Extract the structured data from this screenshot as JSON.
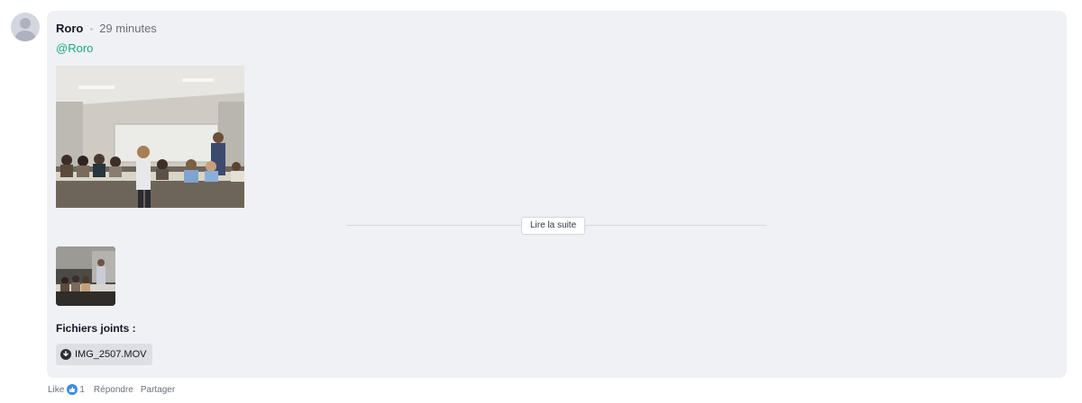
{
  "post": {
    "author": "Roro",
    "time": "29 minutes",
    "mention": "@Roro",
    "read_more_label": "Lire la suite"
  },
  "attachments": {
    "title": "Fichiers joints :",
    "files": [
      {
        "name": "IMG_2507.MOV",
        "icon": "download-icon"
      }
    ]
  },
  "actions": {
    "like_label": "Like",
    "like_count": "1",
    "reply_label": "Répondre",
    "share_label": "Partager"
  },
  "colors": {
    "card_background": "#f0f1f5",
    "mention": "#1aaa86",
    "like_badge": "#3b8be0"
  }
}
